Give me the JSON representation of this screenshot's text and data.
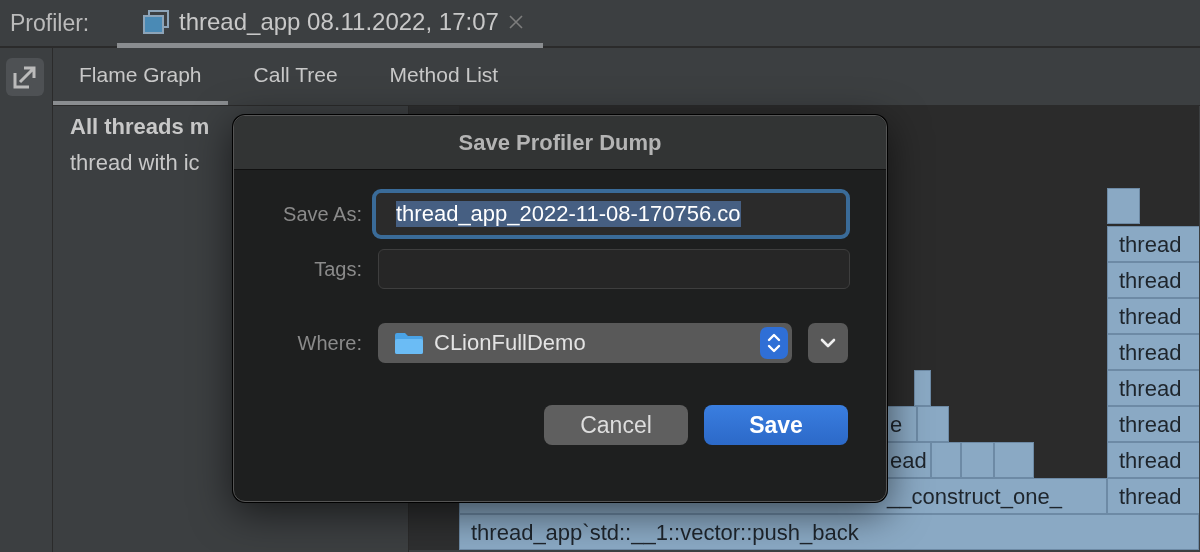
{
  "header": {
    "label": "Profiler:",
    "tab": {
      "title": "thread_app 08.11.2022, 17:07",
      "selected": true
    }
  },
  "view_tabs": [
    {
      "label": "Flame Graph",
      "selected": true
    },
    {
      "label": "Call Tree",
      "selected": false
    },
    {
      "label": "Method List",
      "selected": false
    }
  ],
  "threads_panel": {
    "heading": "All threads m",
    "text": "thread with ic"
  },
  "flame_graph": {
    "frames": [
      {
        "label": "thread"
      },
      {
        "label": "thread"
      },
      {
        "label": "thread"
      },
      {
        "label": "thread"
      },
      {
        "label": "thread"
      },
      {
        "label": "e"
      },
      {
        "label": "thread"
      },
      {
        "label": "ead"
      },
      {
        "label": "thread"
      },
      {
        "label": "__construct_one_"
      },
      {
        "label": "thread"
      },
      {
        "label": "thread_app`std::__1::vector::push_back"
      }
    ]
  },
  "dialog": {
    "title": "Save Profiler Dump",
    "save_as": {
      "label": "Save As:",
      "value": "thread_app_2022-11-08-170756.co"
    },
    "tags": {
      "label": "Tags:"
    },
    "where": {
      "label": "Where:",
      "value": "CLionFullDemo"
    },
    "buttons": [
      {
        "label": "Cancel",
        "default": false
      },
      {
        "label": "Save",
        "default": true
      }
    ]
  }
}
